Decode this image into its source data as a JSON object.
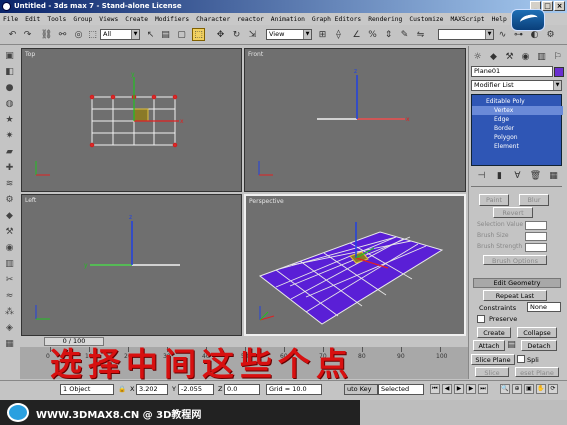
{
  "window": {
    "title": "Untitled - 3ds max 7 - Stand-alone License"
  },
  "menu": [
    "File",
    "Edit",
    "Tools",
    "Group",
    "Views",
    "Create",
    "Modifiers",
    "Character",
    "reactor",
    "Animation",
    "Graph Editors",
    "Rendering",
    "Customize",
    "MAXScript",
    "Help"
  ],
  "toolbar": {
    "selection_filter": "All",
    "ref_coord": "View"
  },
  "viewports": {
    "top": {
      "label": "Top"
    },
    "front": {
      "label": "Front"
    },
    "left": {
      "label": "Left"
    },
    "perspective": {
      "label": "Perspective"
    }
  },
  "command_panel": {
    "object_name": "Plane01",
    "modifier_list": "Modifier List",
    "stack": [
      "Editable Poly",
      "Vertex",
      "Edge",
      "Border",
      "Polygon",
      "Element"
    ],
    "selected_stack_item": "Vertex",
    "paint_buttons": [
      "Paint",
      "Blur",
      "Revert"
    ],
    "selection_value_label": "Selection Value",
    "brush_size_label": "Brush Size",
    "brush_strength_label": "Brush Strength",
    "brush_options": "Brush Options",
    "edit_geometry": "Edit Geometry",
    "repeat_last": "Repeat Last",
    "constraints_label": "Constraints",
    "constraints_value": "None",
    "preserve_label": "Preserve",
    "create": "Create",
    "collapse": "Collapse",
    "attach": "Attach",
    "detach": "Detach",
    "slice_plane": "Slice Plane",
    "split": "Spli",
    "slice": "Slice",
    "reset_plane": "eset Plane"
  },
  "timeline": {
    "frame": "0 / 100",
    "ticks": [
      "0",
      "10",
      "20",
      "30",
      "40",
      "50",
      "60",
      "70",
      "80",
      "90",
      "100"
    ]
  },
  "status": {
    "selection": "1 Object",
    "x_label": "X",
    "x_value": "3.202",
    "y_label": "Y",
    "y_value": "-2.055",
    "z_label": "Z",
    "z_value": "0.0",
    "grid": "Grid = 10.0",
    "auto_key": "uto Key",
    "selected": "Selected"
  },
  "overlay_text": "选择中间这些个点",
  "watermark": "WWW.3DMAX8.CN @ 3D教程网"
}
